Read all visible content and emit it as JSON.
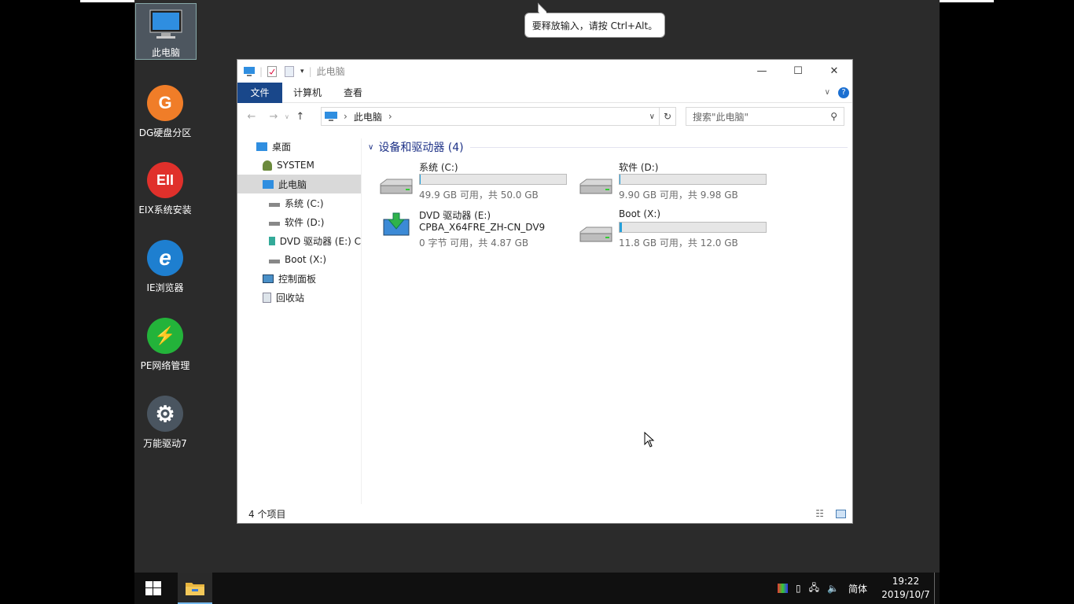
{
  "tooltip": "要释放输入，请按 Ctrl+Alt。",
  "desktop_icons": [
    {
      "label": "此电脑",
      "icon": "computer-icon",
      "color": "#2b6cb3"
    },
    {
      "label": "DG硬盘分区",
      "icon": "dg-icon",
      "glyph": "G",
      "color": "#f07d28"
    },
    {
      "label": "EIX系统安装",
      "icon": "eix-icon",
      "glyph": "EII",
      "color": "#e0302b"
    },
    {
      "label": "IE浏览器",
      "icon": "ie-icon",
      "glyph": "e",
      "color": "#1e7fd0"
    },
    {
      "label": "PE网络管理",
      "icon": "pe-network-icon",
      "glyph": "⚡",
      "color": "#23b33a"
    },
    {
      "label": "万能驱动7",
      "icon": "gear-icon",
      "glyph": "⚙",
      "color": "#4a5560"
    }
  ],
  "window": {
    "title": "此电脑",
    "ribbon_tabs": [
      "文件",
      "计算机",
      "查看"
    ],
    "address": {
      "path": "此电脑"
    },
    "search": {
      "placeholder": "搜索\"此电脑\""
    },
    "nav_items": [
      {
        "label": "桌面",
        "icon": "desktop-icon"
      },
      {
        "label": "SYSTEM",
        "icon": "user-icon"
      },
      {
        "label": "此电脑",
        "icon": "computer-icon"
      },
      {
        "label": "系统 (C:)",
        "icon": "drive-icon"
      },
      {
        "label": "软件 (D:)",
        "icon": "drive-icon"
      },
      {
        "label": "DVD 驱动器 (E:) C",
        "icon": "dvd-icon"
      },
      {
        "label": "Boot (X:)",
        "icon": "drive-icon"
      },
      {
        "label": "控制面板",
        "icon": "control-panel-icon"
      },
      {
        "label": "回收站",
        "icon": "recycle-bin-icon"
      }
    ],
    "group_header": "设备和驱动器 (4)",
    "drives": [
      {
        "name": "系统 (C:)",
        "free_text": "49.9 GB 可用，共 50.0 GB",
        "used_fraction": 0.002
      },
      {
        "name": "软件 (D:)",
        "free_text": "9.90 GB 可用，共 9.98 GB",
        "used_fraction": 0.008
      },
      {
        "name": "DVD 驱动器 (E:)",
        "label2": "CPBA_X64FRE_ZH-CN_DV9",
        "free_text": "0 字节 可用，共 4.87 GB"
      },
      {
        "name": "Boot (X:)",
        "free_text": "11.8 GB 可用，共 12.0 GB",
        "used_fraction": 0.017
      }
    ],
    "status": "4 个项目"
  },
  "taskbar": {
    "ime": "简体",
    "time": "19:22",
    "date": "2019/10/7"
  },
  "colors": {
    "accent": "#19478a",
    "progress": "#26a0da"
  }
}
